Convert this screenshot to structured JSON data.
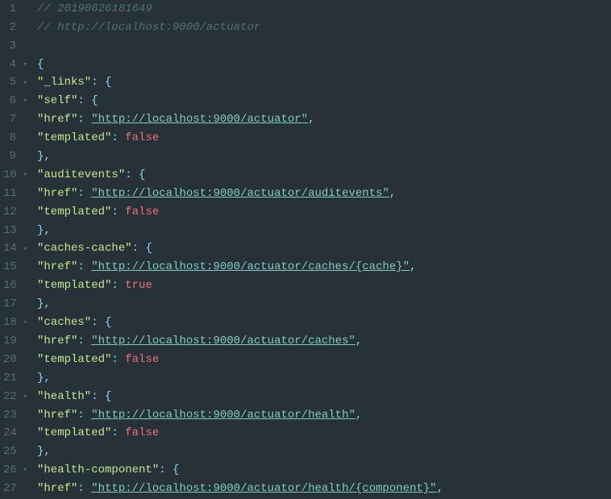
{
  "comments": {
    "timestamp": "// 20190626181649",
    "url": "// http://localhost:9000/actuator"
  },
  "json": {
    "links_key": "\"_links\"",
    "href_key": "\"href\"",
    "templated_key": "\"templated\"",
    "false_val": "false",
    "true_val": "true",
    "self": {
      "key": "\"self\"",
      "href": "\"http://localhost:9000/actuator\""
    },
    "auditevents": {
      "key": "\"auditevents\"",
      "href": "\"http://localhost:9000/actuator/auditevents\""
    },
    "caches_cache": {
      "key": "\"caches-cache\"",
      "href": "\"http://localhost:9000/actuator/caches/{cache}\""
    },
    "caches": {
      "key": "\"caches\"",
      "href": "\"http://localhost:9000/actuator/caches\""
    },
    "health": {
      "key": "\"health\"",
      "href": "\"http://localhost:9000/actuator/health\""
    },
    "health_component": {
      "key": "\"health-component\"",
      "href": "\"http://localhost:9000/actuator/health/{component}\""
    }
  },
  "lines": [
    {
      "num": "1",
      "fold": ""
    },
    {
      "num": "2",
      "fold": ""
    },
    {
      "num": "3",
      "fold": ""
    },
    {
      "num": "4",
      "fold": "▾"
    },
    {
      "num": "5",
      "fold": "▾"
    },
    {
      "num": "6",
      "fold": "▾"
    },
    {
      "num": "7",
      "fold": ""
    },
    {
      "num": "8",
      "fold": ""
    },
    {
      "num": "9",
      "fold": ""
    },
    {
      "num": "10",
      "fold": "▾"
    },
    {
      "num": "11",
      "fold": ""
    },
    {
      "num": "12",
      "fold": ""
    },
    {
      "num": "13",
      "fold": ""
    },
    {
      "num": "14",
      "fold": "▾"
    },
    {
      "num": "15",
      "fold": ""
    },
    {
      "num": "16",
      "fold": ""
    },
    {
      "num": "17",
      "fold": ""
    },
    {
      "num": "18",
      "fold": "▾"
    },
    {
      "num": "19",
      "fold": ""
    },
    {
      "num": "20",
      "fold": ""
    },
    {
      "num": "21",
      "fold": ""
    },
    {
      "num": "22",
      "fold": "▾"
    },
    {
      "num": "23",
      "fold": ""
    },
    {
      "num": "24",
      "fold": ""
    },
    {
      "num": "25",
      "fold": ""
    },
    {
      "num": "26",
      "fold": "▾"
    },
    {
      "num": "27",
      "fold": ""
    }
  ]
}
